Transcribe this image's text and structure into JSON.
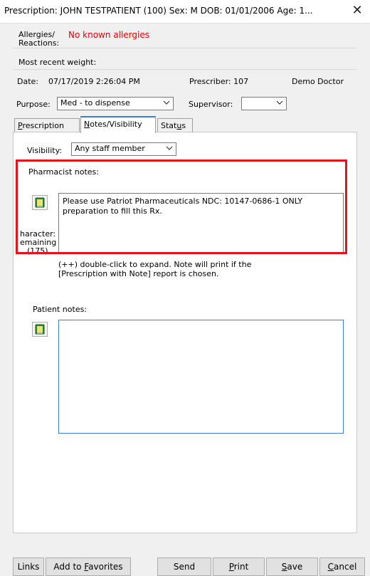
{
  "window": {
    "title": "Prescription: JOHN TESTPATIENT (100)  Sex: M  DOB: 01/01/2006  Age: 1...",
    "close_glyph": "✕"
  },
  "patient": {
    "allergies_label_1": "Allergies/",
    "allergies_label_2": "Reactions:",
    "allergies_value": "No known allergies",
    "weight_label": "Most recent weight:"
  },
  "rx": {
    "date_label": "Date:",
    "date_value": "07/17/2019 2:26:04 PM",
    "prescriber_label": "Prescriber: 107",
    "prescriber_name": "Demo Doctor",
    "purpose_label": "Purpose:",
    "purpose_value": "Med - to dispense",
    "supervisor_label": "Supervisor:",
    "supervisor_value": ""
  },
  "tabs": {
    "prescription": {
      "pre": "",
      "ul": "P",
      "post": "rescription"
    },
    "notes": {
      "pre": "",
      "ul": "N",
      "post": "otes/Visibility"
    },
    "status": {
      "pre": "Stat",
      "ul": "u",
      "post": "s"
    }
  },
  "notes_tab": {
    "visibility_label": "Visibility:",
    "visibility_value": "Any staff member",
    "pharmacist_label": "Pharmacist notes:",
    "pharmacist_note": "Please use Patriot Pharmaceuticals NDC: 10147-0686-1 ONLY preparation to fill this Rx.",
    "chars_line1": "haracter:",
    "chars_line2": "emaining",
    "chars_line3": "(175)",
    "hint_line1": "(++) double-click to expand. Note will print if the",
    "hint_line2": "[Prescription with Note] report is chosen.",
    "patient_label": "Patient notes:",
    "patient_note": ""
  },
  "buttons": {
    "links": "Links",
    "add_fav": {
      "pre": "Add to ",
      "ul": "F",
      "post": "avorites"
    },
    "send": "Send",
    "print": {
      "pre": "",
      "ul": "P",
      "post": "rint"
    },
    "save": {
      "pre": "",
      "ul": "S",
      "post": "ave"
    },
    "cancel": {
      "pre": "",
      "ul": "C",
      "post": "ancel"
    }
  },
  "colors": {
    "highlight_rect": "#e2141d",
    "allergy_text": "#e00000",
    "patient_box_border": "#3c7fd0"
  },
  "icons": [
    "close-icon",
    "chevron-down-icon",
    "book-icon"
  ]
}
